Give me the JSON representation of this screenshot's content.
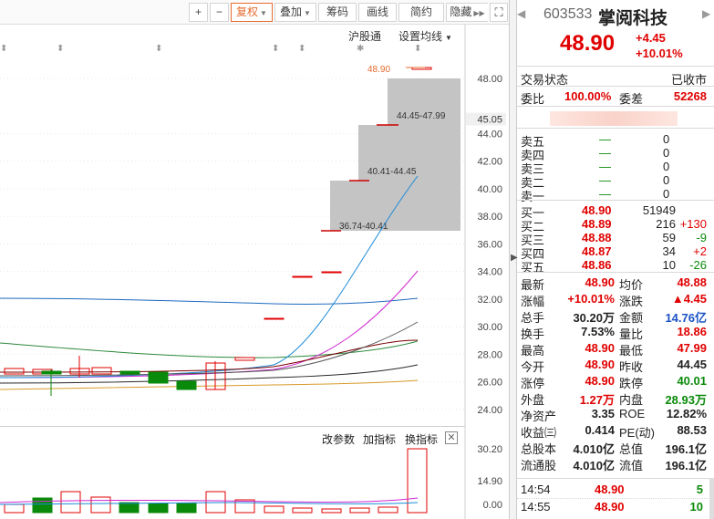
{
  "toolbar": {
    "zoom_in": "+",
    "zoom_out": "−",
    "fuquan": "复权",
    "diejia": "叠加",
    "choumao": "筹码",
    "huaxian": "画线",
    "jianyue": "简约",
    "yincang": "隐藏"
  },
  "chart_header": {
    "hugutong": "沪股通",
    "set_ma": "设置均线"
  },
  "price_axis": {
    "ticks": [
      "48.00",
      "45.05",
      "44.00",
      "42.00",
      "40.00",
      "38.00",
      "36.00",
      "34.00",
      "32.00",
      "30.00",
      "28.00",
      "26.00",
      "24.00"
    ],
    "current_label": "45.05",
    "peak_label": "48.90"
  },
  "chip_labels": [
    "44.45-47.99",
    "40.41-44.45",
    "36.74-40.41"
  ],
  "volume_header": {
    "params": "改参数",
    "add": "加指标",
    "switch": "换指标"
  },
  "volume_axis": [
    "30.20",
    "14.90",
    "0.00"
  ],
  "stock": {
    "code": "603533",
    "name": "掌阅科技",
    "price": "48.90",
    "change": "+4.45",
    "change_pct": "+10.01%"
  },
  "status": {
    "label": "交易状态",
    "value": "已收市"
  },
  "weibi": {
    "label": "委比",
    "value": "100.00%",
    "diff_label": "委差",
    "diff_value": "52268"
  },
  "sell_orders": [
    {
      "label": "卖五",
      "price": "—",
      "vol": "0"
    },
    {
      "label": "卖四",
      "price": "—",
      "vol": "0"
    },
    {
      "label": "卖三",
      "price": "—",
      "vol": "0"
    },
    {
      "label": "卖二",
      "price": "—",
      "vol": "0"
    },
    {
      "label": "卖一",
      "price": "—",
      "vol": "0"
    }
  ],
  "buy_orders": [
    {
      "label": "买一",
      "price": "48.90",
      "vol": "51949",
      "chg": ""
    },
    {
      "label": "买二",
      "price": "48.89",
      "vol": "216",
      "chg": "+130"
    },
    {
      "label": "买三",
      "price": "48.88",
      "vol": "59",
      "chg": "-9"
    },
    {
      "label": "买四",
      "price": "48.87",
      "vol": "34",
      "chg": "+2"
    },
    {
      "label": "买五",
      "price": "48.86",
      "vol": "10",
      "chg": "-26"
    }
  ],
  "stats": [
    {
      "l1": "最新",
      "v1": "48.90",
      "c1": "red",
      "l2": "均价",
      "v2": "48.88",
      "c2": "red"
    },
    {
      "l1": "涨幅",
      "v1": "+10.01%",
      "c1": "red",
      "l2": "涨跌",
      "v2": "▲4.45",
      "c2": "red"
    },
    {
      "l1": "总手",
      "v1": "30.20万",
      "c1": "dark",
      "l2": "金额",
      "v2": "14.76亿",
      "c2": "blue"
    },
    {
      "l1": "换手",
      "v1": "7.53%",
      "c1": "dark",
      "l2": "量比",
      "v2": "18.86",
      "c2": "red"
    },
    {
      "l1": "最高",
      "v1": "48.90",
      "c1": "red",
      "l2": "最低",
      "v2": "47.99",
      "c2": "red"
    },
    {
      "l1": "今开",
      "v1": "48.90",
      "c1": "red",
      "l2": "昨收",
      "v2": "44.45",
      "c2": "dark"
    },
    {
      "l1": "涨停",
      "v1": "48.90",
      "c1": "red",
      "l2": "跌停",
      "v2": "40.01",
      "c2": "green"
    },
    {
      "l1": "外盘",
      "v1": "1.27万",
      "c1": "red",
      "l2": "内盘",
      "v2": "28.93万",
      "c2": "green"
    },
    {
      "l1": "净资产",
      "v1": "3.35",
      "c1": "dark",
      "l2": "ROE",
      "v2": "12.82%",
      "c2": "dark"
    },
    {
      "l1": "收益㈢",
      "v1": "0.414",
      "c1": "dark",
      "l2": "PE(动)",
      "v2": "88.53",
      "c2": "dark"
    },
    {
      "l1": "总股本",
      "v1": "4.010亿",
      "c1": "dark",
      "l2": "总值",
      "v2": "196.1亿",
      "c2": "dark"
    },
    {
      "l1": "流通股",
      "v1": "4.010亿",
      "c1": "dark",
      "l2": "流值",
      "v2": "196.1亿",
      "c2": "dark"
    }
  ],
  "ticks": [
    {
      "time": "14:54",
      "price": "48.90",
      "vol": "5"
    },
    {
      "time": "14:55",
      "price": "48.90",
      "vol": "10"
    }
  ],
  "colors": {
    "up": "#e00000",
    "down": "#0a8a0a",
    "accent": "#e56b2e"
  }
}
